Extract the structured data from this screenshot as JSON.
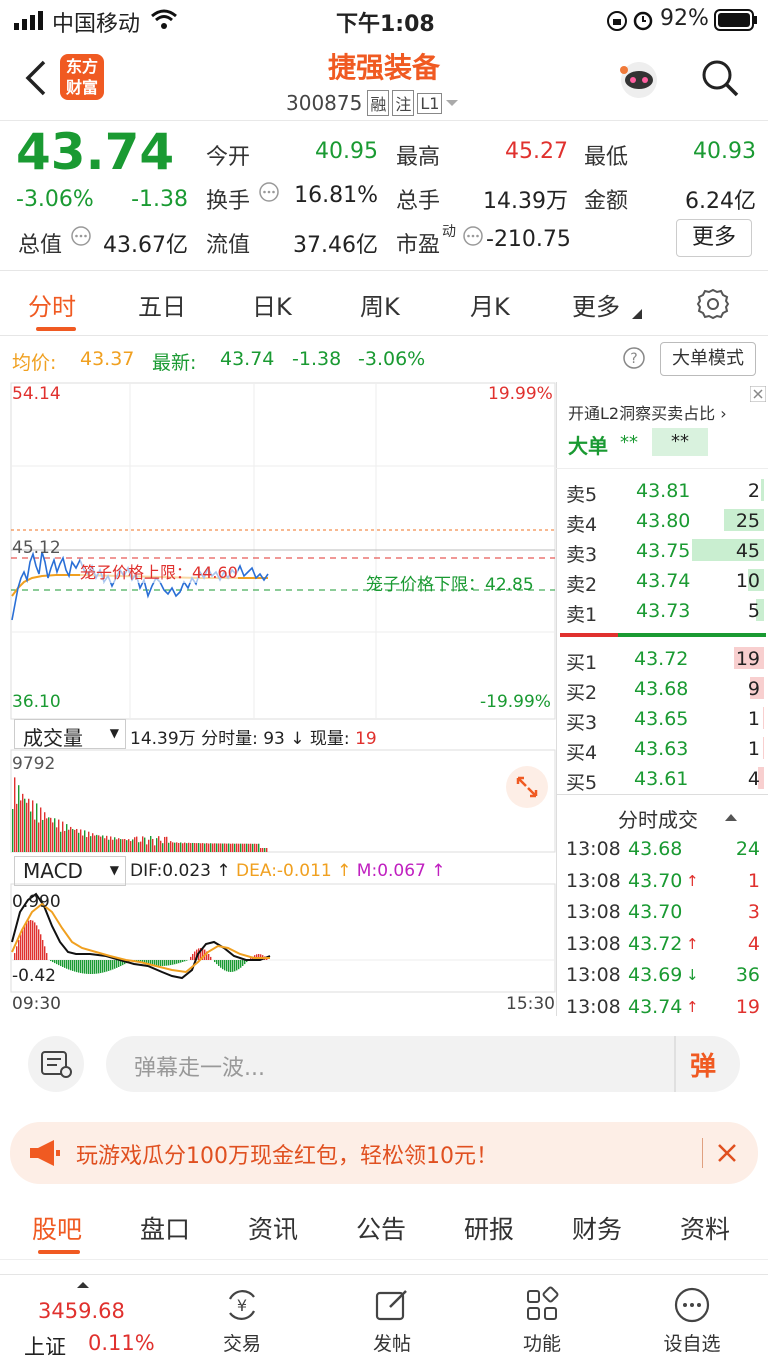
{
  "status": {
    "carrier": "中国移动",
    "time": "下午1:08",
    "battery": "92%"
  },
  "nav": {
    "logo_line1": "东方",
    "logo_line2": "财富",
    "title": "捷强装备",
    "code": "300875",
    "tag1": "融",
    "tag2": "注",
    "tag3": "L1"
  },
  "quote": {
    "price": "43.74",
    "pct": "-3.06%",
    "chg": "-1.38",
    "open_label": "今开",
    "open": "40.95",
    "high_label": "最高",
    "high": "45.27",
    "low_label": "最低",
    "low": "40.93",
    "turnover_label": "换手",
    "turnover": "16.81%",
    "volume_label": "总手",
    "volume": "14.39万",
    "amount_label": "金额",
    "amount": "6.24亿",
    "mktcap_label": "总值",
    "mktcap": "43.67亿",
    "float_label": "流值",
    "float": "37.46亿",
    "pe_label": "市盈",
    "pe_sup": "动",
    "pe": "-210.75",
    "more": "更多"
  },
  "tabs": [
    "分时",
    "五日",
    "日K",
    "周K",
    "月K",
    "更多"
  ],
  "avg": {
    "avg_label": "均价:",
    "avg_value": "43.37",
    "latest_label": "最新:",
    "latest_value": "43.74",
    "chg": "-1.38",
    "pct": "-3.06%",
    "mode_button": "大单模式"
  },
  "chart": {
    "y_top": "54.14",
    "y_bottom": "36.10",
    "pct_top": "19.99%",
    "pct_bottom": "-19.99%",
    "mid_price": "45.12",
    "cage_upper_label": "笼子价格上限：44.60",
    "cage_lower_label": "笼子价格下限：42.85",
    "vol_select": "成交量",
    "vol_total": "14.39万",
    "vol_tick_label": "分时量:",
    "vol_tick": "93",
    "vol_now_label": "现量:",
    "vol_now": "19",
    "vol_max": "9792",
    "macd_select": "MACD",
    "dif": "DIF:0.023",
    "dea": "DEA:-0.011",
    "m": "M:0.067",
    "macd_top": "0.990",
    "macd_bottom": "-0.42",
    "t_start": "09:30",
    "t_end": "15:30"
  },
  "colors": {
    "red": "#e0312e",
    "green": "#1a9a32",
    "orange": "#f07020",
    "avg": "#f0a020",
    "price": "#2a6fd6"
  },
  "book": {
    "l2_text": "开通L2洞察买卖占比",
    "big_label": "大单",
    "big_a": "**",
    "big_b": "**",
    "asks": [
      {
        "label": "卖5",
        "price": "43.81",
        "qty": "2",
        "bar": 0.04
      },
      {
        "label": "卖4",
        "price": "43.80",
        "qty": "25",
        "bar": 0.55
      },
      {
        "label": "卖3",
        "price": "43.75",
        "qty": "45",
        "bar": 1.0
      },
      {
        "label": "卖2",
        "price": "43.74",
        "qty": "10",
        "bar": 0.22
      },
      {
        "label": "卖1",
        "price": "43.73",
        "qty": "5",
        "bar": 0.11
      }
    ],
    "bids": [
      {
        "label": "买1",
        "price": "43.72",
        "qty": "19",
        "bar": 0.42
      },
      {
        "label": "买2",
        "price": "43.68",
        "qty": "9",
        "bar": 0.2
      },
      {
        "label": "买3",
        "price": "43.65",
        "qty": "1",
        "bar": 0.02
      },
      {
        "label": "买4",
        "price": "43.63",
        "qty": "1",
        "bar": 0.02
      },
      {
        "label": "买5",
        "price": "43.61",
        "qty": "4",
        "bar": 0.09
      }
    ],
    "ticks_title": "分时成交",
    "ticks": [
      {
        "time": "13:08",
        "price": "43.68",
        "arrow": "",
        "qty": "24",
        "qty_color": "green"
      },
      {
        "time": "13:08",
        "price": "43.70",
        "arrow": "↑",
        "qty": "1",
        "qty_color": "red"
      },
      {
        "time": "13:08",
        "price": "43.70",
        "arrow": "",
        "qty": "3",
        "qty_color": "red"
      },
      {
        "time": "13:08",
        "price": "43.72",
        "arrow": "↑",
        "qty": "4",
        "qty_color": "red"
      },
      {
        "time": "13:08",
        "price": "43.69",
        "arrow": "↓",
        "qty": "36",
        "qty_color": "green"
      },
      {
        "time": "13:08",
        "price": "43.74",
        "arrow": "↑",
        "qty": "19",
        "qty_color": "red"
      }
    ]
  },
  "comment": {
    "placeholder": "弹幕走一波...",
    "dan": "弹"
  },
  "banner": {
    "text": "玩游戏瓜分100万现金红包，轻松领10元！"
  },
  "bottom_tabs": [
    "股吧",
    "盘口",
    "资讯",
    "公告",
    "研报",
    "财务",
    "资料"
  ],
  "footer": {
    "index_value": "3459.68",
    "index_name": "上证",
    "index_pct": "0.11%",
    "items": [
      "交易",
      "发帖",
      "功能",
      "设自选"
    ]
  }
}
